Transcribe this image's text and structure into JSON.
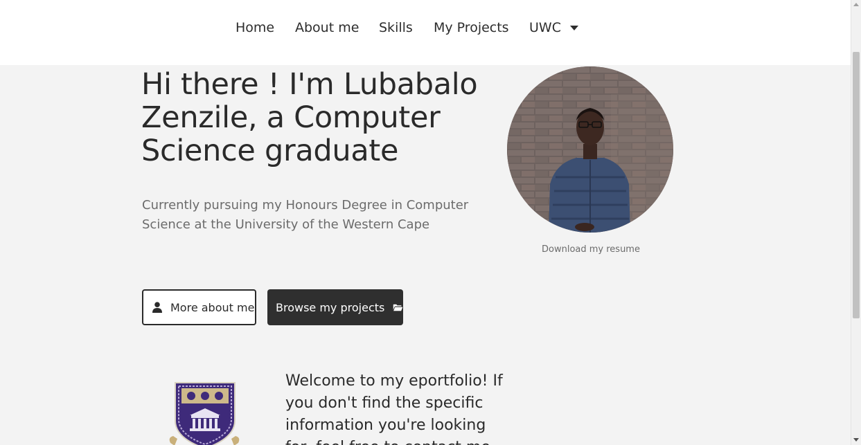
{
  "nav": {
    "items": [
      {
        "label": "Home"
      },
      {
        "label": "About me"
      },
      {
        "label": "Skills"
      },
      {
        "label": "My Projects"
      },
      {
        "label": "UWC"
      }
    ]
  },
  "hero": {
    "title": "Hi there ! I'm Lubabalo Zenzile, a Computer Science graduate",
    "subtitle": "Currently pursuing my Honours Degree in Computer Science at the University of the Western Cape",
    "resume_link": "Download my resume",
    "buttons": {
      "about": {
        "label": "More about me",
        "icon": "user-icon"
      },
      "projects": {
        "label": "Browse my projects",
        "icon": "folder-open-icon"
      }
    }
  },
  "intro": {
    "welcome": "Welcome to my eportfolio! If you don't find the specific information you're looking for, feel free to contact me"
  },
  "colors": {
    "background": "#f3f3f3",
    "navbar": "#ffffff",
    "text": "#2a2a2a",
    "muted": "#6b6b6b",
    "dark_button": "#2f2f2f"
  }
}
